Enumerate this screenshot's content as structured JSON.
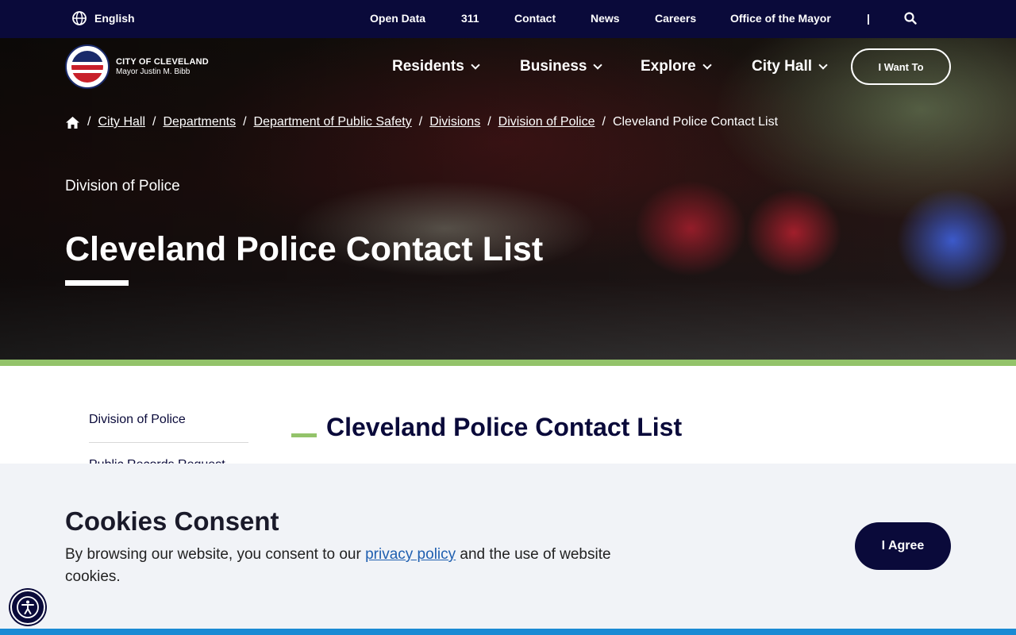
{
  "utility": {
    "language": "English",
    "links": [
      "Open Data",
      "311",
      "Contact",
      "News",
      "Careers",
      "Office of the Mayor"
    ],
    "separator": "|",
    "icons": {
      "language": "globe-icon",
      "search": "search-icon"
    }
  },
  "logo": {
    "name": "CITY OF CLEVELAND",
    "mayor": "Mayor Justin M. Bibb"
  },
  "nav": {
    "items": [
      "Residents",
      "Business",
      "Explore",
      "City Hall"
    ],
    "cta": "I Want To"
  },
  "breadcrumb": {
    "home_icon": "home-icon",
    "links": [
      "City Hall",
      "Departments",
      "Department of Public Safety",
      "Divisions",
      "Division of Police"
    ],
    "current": "Cleveland Police Contact List",
    "separator": "/"
  },
  "hero": {
    "subtitle": "Division of Police",
    "title": "Cleveland Police Contact List"
  },
  "sidebar": {
    "items": [
      "Division of Police",
      "Public Records Request"
    ]
  },
  "content": {
    "title": "Cleveland Police Contact List"
  },
  "cookie": {
    "title": "Cookies Consent",
    "text_before": "By browsing our website, you consent to our ",
    "link": "privacy policy",
    "text_after": " and the use of website cookies.",
    "button": "I Agree"
  },
  "accessibility": {
    "icon": "accessibility-icon"
  },
  "colors": {
    "navy": "#0a0a3a",
    "green": "#93c36a",
    "blue": "#1a8ad4",
    "link": "#1f5fb0"
  }
}
